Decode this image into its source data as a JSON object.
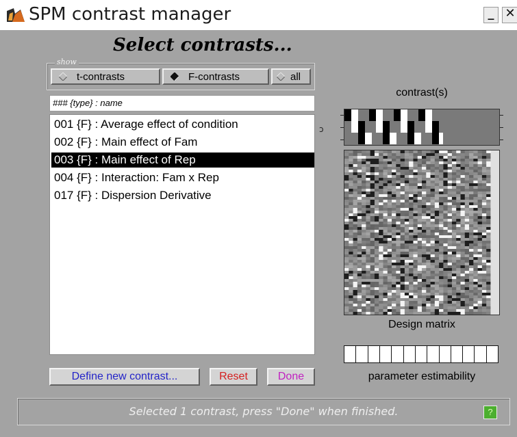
{
  "window": {
    "title": "SPM contrast manager",
    "minimize_label": "_",
    "close_label": "✕"
  },
  "heading": "Select contrasts...",
  "show_group": {
    "label": "show",
    "options": [
      {
        "label": "t-contrasts",
        "selected": false
      },
      {
        "label": "F-contrasts",
        "selected": true
      },
      {
        "label": "all",
        "selected": false
      }
    ]
  },
  "list": {
    "header": "### {type} : name",
    "items": [
      {
        "label": "001 {F} : Average effect of condition",
        "selected": false
      },
      {
        "label": "002 {F} : Main effect of Fam",
        "selected": false
      },
      {
        "label": "003 {F} : Main effect of Rep",
        "selected": true
      },
      {
        "label": "004 {F} : Interaction: Fam x Rep",
        "selected": false
      },
      {
        "label": "017 {F} : Dispersion Derivative",
        "selected": false
      }
    ]
  },
  "buttons": {
    "define": {
      "label": "Define new contrast...",
      "color": "#2323c8"
    },
    "reset": {
      "label": "Reset",
      "color": "#d42020"
    },
    "done": {
      "label": "Done",
      "color": "#c020c0"
    }
  },
  "right_panel": {
    "contrast_label": "contrast(s)",
    "side_glyph": "ɔ",
    "design_label": "Design matrix",
    "estimability_label": "parameter estimability",
    "estimability_cells": 13
  },
  "status": {
    "text": "Selected 1 contrast, press \"Done\" when finished.",
    "help_label": "?"
  },
  "colors": {
    "window_bg": "#a3a3a3",
    "selection_bg": "#000000",
    "help_green": "#4caf2f"
  }
}
